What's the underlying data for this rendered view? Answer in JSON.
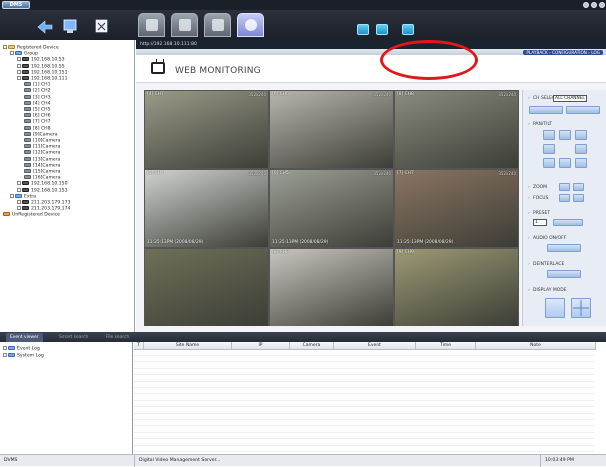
{
  "app": {
    "logo": "DMS"
  },
  "tree": [
    {
      "label": "Registered Device",
      "icon": "device",
      "lvl": 0,
      "pm": "-"
    },
    {
      "label": "Group",
      "icon": "group",
      "lvl": 1,
      "pm": "-"
    },
    {
      "label": "192.168.10.53",
      "icon": "dvr",
      "lvl": 2,
      "pm": "+"
    },
    {
      "label": "192.168.10.55",
      "icon": "dvr",
      "lvl": 2,
      "pm": "+"
    },
    {
      "label": "192.168.10.151",
      "icon": "dvr",
      "lvl": 2,
      "pm": "+"
    },
    {
      "label": "192.168.10.111",
      "icon": "dvr",
      "lvl": 2,
      "pm": "-"
    },
    {
      "label": "[1] CH1",
      "icon": "cam",
      "lvl": 3
    },
    {
      "label": "[2] CH2",
      "icon": "cam",
      "lvl": 3
    },
    {
      "label": "[3] CH3",
      "icon": "cam",
      "lvl": 3
    },
    {
      "label": "[4] CH4",
      "icon": "cam",
      "lvl": 3
    },
    {
      "label": "[5] CH5",
      "icon": "cam",
      "lvl": 3
    },
    {
      "label": "[6] CH6",
      "icon": "cam",
      "lvl": 3
    },
    {
      "label": "[7] CH7",
      "icon": "cam",
      "lvl": 3
    },
    {
      "label": "[8] CH8",
      "icon": "cam",
      "lvl": 3
    },
    {
      "label": "[9]Camera",
      "icon": "cam",
      "lvl": 3
    },
    {
      "label": "[10]Camera",
      "icon": "cam",
      "lvl": 3
    },
    {
      "label": "[11]Camera",
      "icon": "cam",
      "lvl": 3
    },
    {
      "label": "[12]Camera",
      "icon": "cam",
      "lvl": 3
    },
    {
      "label": "[13]Camera",
      "icon": "cam",
      "lvl": 3
    },
    {
      "label": "[14]Camera",
      "icon": "cam",
      "lvl": 3
    },
    {
      "label": "[15]Camera",
      "icon": "cam",
      "lvl": 3
    },
    {
      "label": "[16]Camera",
      "icon": "cam",
      "lvl": 3
    },
    {
      "label": "192.168.10.150",
      "icon": "dvr",
      "lvl": 2,
      "pm": "+"
    },
    {
      "label": "192.168.10.153",
      "icon": "dvr",
      "lvl": 2,
      "pm": "+"
    },
    {
      "label": "Extra",
      "icon": "group",
      "lvl": 1,
      "pm": "-"
    },
    {
      "label": "211.203.179.173",
      "icon": "dvr",
      "lvl": 2,
      "pm": "+"
    },
    {
      "label": "211.203.179.174",
      "icon": "dvr",
      "lvl": 2,
      "pm": "+"
    },
    {
      "label": "UnRegistered Device",
      "icon": "unreg",
      "lvl": 0
    }
  ],
  "web": {
    "url": "http://192.168.10.111:80",
    "nav": "PLAYBACK  ›  CONFIGURATION  ›  LOG",
    "title": "WEB MONITORING"
  },
  "cells": [
    {
      "label": "[4] CH7",
      "res": "352x240",
      "ts": "",
      "bg": "#9a9b88"
    },
    {
      "label": "[6] CH6",
      "res": "352x240",
      "ts": "",
      "bg": "#b8b6ad"
    },
    {
      "label": "[8] CH8",
      "res": "352x240",
      "ts": "",
      "bg": "#8a8c7e"
    },
    {
      "label": "[5] CH4",
      "res": "352x240",
      "ts": "11:25:13PM (2008/08/29)",
      "bg": "#cfd2cf"
    },
    {
      "label": "[6] CH5",
      "res": "352x240",
      "ts": "11:25:13PM (2008/08/29)",
      "bg": "#9da095"
    },
    {
      "label": "[7] CH7",
      "res": "352x240",
      "ts": "11:25:13PM (2008/08/29)",
      "bg": "#8b7562"
    },
    {
      "label": "",
      "res": "",
      "ts": "",
      "bg": "#6f7058"
    },
    {
      "label": "[8] CH8",
      "res": "",
      "ts": "",
      "bg": "#c9c6be"
    },
    {
      "label": "[9] CH9",
      "res": "",
      "ts": "",
      "bg": "#9c9a74"
    }
  ],
  "cellts": [
    "11:25:13PM (2008/08/29)",
    "11:25:13PM (2008/08/29)",
    "11:25:13PM (2008/08/29)"
  ],
  "panel": {
    "ch_select_label": "CH SELECT",
    "ch_select_value": "ALL CHANNEL",
    "pan": "PAN/TILT",
    "zoom": "ZOOM",
    "focus": "FOCUS",
    "preset": "PRESET",
    "preset_value": "1",
    "audio": "AUDIO ON/OFF",
    "deint": "DEINTERLACE",
    "display": "DISPLAY MODE"
  },
  "events": {
    "tabs": [
      "Event viewer",
      "Smart search",
      "File search"
    ],
    "tree": [
      "Event Log",
      "System Log"
    ],
    "columns": [
      "T",
      "Site Name",
      "IP",
      "Camera",
      "Event",
      "Time",
      "Note"
    ]
  },
  "status": {
    "app": "DVMS",
    "msg": "Digital Video Management Server...",
    "time": "10:03:49 PM"
  }
}
